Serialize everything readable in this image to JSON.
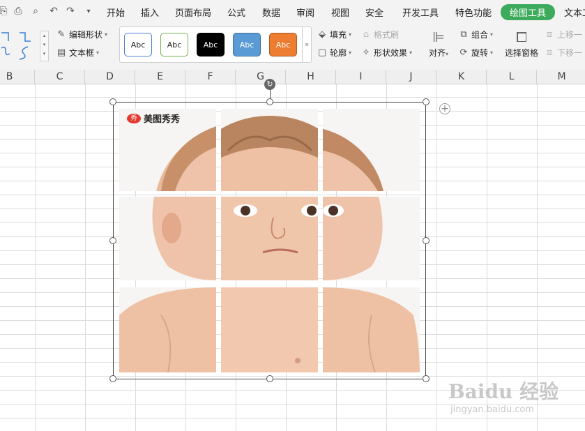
{
  "quick_access": [
    {
      "icon": "paste-icon",
      "glyph": "⎘"
    },
    {
      "icon": "print-icon",
      "glyph": "⎙"
    },
    {
      "icon": "print-preview-icon",
      "glyph": "🔍"
    },
    {
      "icon": "undo-icon",
      "glyph": "↶"
    },
    {
      "icon": "redo-icon",
      "glyph": "↷"
    },
    {
      "icon": "dropdown-icon",
      "glyph": "▾"
    }
  ],
  "menu": {
    "start": "开始",
    "insert": "插入",
    "page_layout": "页面布局",
    "formula": "公式",
    "data": "数据",
    "review": "审阅",
    "view": "视图",
    "security": "安全",
    "developer": "开发工具",
    "special": "特色功能",
    "drawing_tools": "绘图工具",
    "text_tools": "文本工"
  },
  "ribbon": {
    "edit_shape": "编辑形状",
    "text_box": "文本框",
    "style_label": "Abc",
    "fill": "填充",
    "format_painter": "格式刷",
    "outline": "轮廓",
    "shape_effect": "形状效果",
    "align": "对齐",
    "group": "组合",
    "rotate": "旋转",
    "selection_pane": "选择窗格",
    "bring_forward": "上移一",
    "send_backward": "下移一"
  },
  "columns": [
    "B",
    "C",
    "D",
    "E",
    "F",
    "G",
    "H",
    "I",
    "J",
    "K",
    "L",
    "M"
  ],
  "picture": {
    "watermark_badge": "秀",
    "watermark_text": "美图秀秀"
  },
  "baidu_watermark": {
    "main": "Baidu 经验",
    "sub": "jingyan.baidu.com"
  },
  "colors": {
    "accent": "#3daa5c",
    "style_white": "#ffffff",
    "style_black": "#000000",
    "style_blue": "#5b9bd5",
    "style_orange": "#ed7d31"
  }
}
